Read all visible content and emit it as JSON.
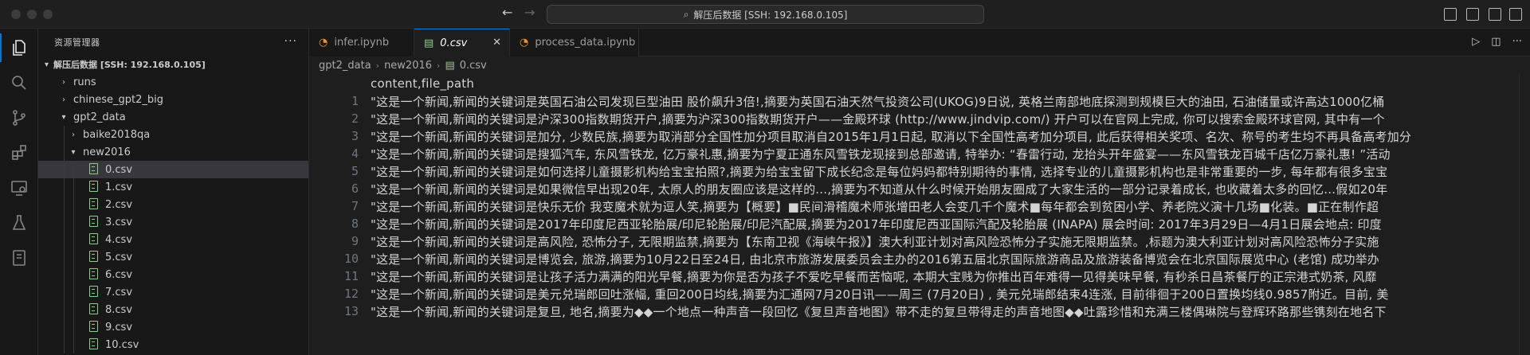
{
  "titlebar": {
    "back_icon": "arrow-left-icon",
    "forward_icon": "arrow-right-icon",
    "search_text": "解压后数据 [SSH: 192.168.0.105]"
  },
  "sidebar": {
    "title": "资源管理器",
    "more_label": "···",
    "section_label": "解压后数据 [SSH: 192.168.0.105]",
    "tree": [
      {
        "label": "runs",
        "type": "folder",
        "depth": 1,
        "expanded": false
      },
      {
        "label": "chinese_gpt2_big",
        "type": "folder",
        "depth": 1,
        "expanded": false
      },
      {
        "label": "gpt2_data",
        "type": "folder",
        "depth": 1,
        "expanded": true
      },
      {
        "label": "baike2018qa",
        "type": "folder",
        "depth": 2,
        "expanded": false
      },
      {
        "label": "new2016",
        "type": "folder",
        "depth": 2,
        "expanded": true
      },
      {
        "label": "0.csv",
        "type": "csv",
        "depth": 3,
        "selected": true
      },
      {
        "label": "1.csv",
        "type": "csv",
        "depth": 3
      },
      {
        "label": "2.csv",
        "type": "csv",
        "depth": 3
      },
      {
        "label": "3.csv",
        "type": "csv",
        "depth": 3
      },
      {
        "label": "4.csv",
        "type": "csv",
        "depth": 3
      },
      {
        "label": "5.csv",
        "type": "csv",
        "depth": 3
      },
      {
        "label": "6.csv",
        "type": "csv",
        "depth": 3
      },
      {
        "label": "7.csv",
        "type": "csv",
        "depth": 3
      },
      {
        "label": "8.csv",
        "type": "csv",
        "depth": 3
      },
      {
        "label": "9.csv",
        "type": "csv",
        "depth": 3
      },
      {
        "label": "10.csv",
        "type": "csv",
        "depth": 3
      }
    ]
  },
  "tabs": [
    {
      "label": "infer.ipynb",
      "icon": "jupyter-icon",
      "active": false
    },
    {
      "label": "0.csv",
      "icon": "csv-icon",
      "active": true,
      "italic": true
    },
    {
      "label": "process_data.ipynb",
      "icon": "jupyter-icon",
      "active": false
    }
  ],
  "breadcrumb": [
    "gpt2_data",
    "new2016",
    "0.csv"
  ],
  "editor": {
    "lines": [
      {
        "n": "",
        "text": "content,file_path"
      },
      {
        "n": "1",
        "text": "\"这是一个新闻,新闻的关键词是英国石油公司发现巨型油田 股价飙升3倍!,摘要为英国石油天然气投资公司(UKOG)9日说, 英格兰南部地底探测到规模巨大的油田, 石油储量或许高达1000亿桶"
      },
      {
        "n": "2",
        "text": "\"这是一个新闻,新闻的关键词是沪深300指数期货开户,摘要为沪深300指数期货开户——金殿环球 (http://www.jindvip.com/) 开户可以在官网上完成, 你可以搜索金殿环球官网, 其中有一个"
      },
      {
        "n": "3",
        "text": "\"这是一个新闻,新闻的关键词是加分, 少数民族,摘要为取消部分全国性加分项目取消自2015年1月1日起, 取消以下全国性高考加分项目, 此后获得相关奖项、名次、称号的考生均不再具备高考加分"
      },
      {
        "n": "4",
        "text": "\"这是一个新闻,新闻的关键词是搜狐汽车, 东风雪铁龙, 亿万豪礼惠,摘要为宁夏正通东风雪铁龙现接到总部邀请, 特举办: “春雷行动, 龙抬头开年盛宴——东风雪铁龙百城千店亿万豪礼惠! ”活动"
      },
      {
        "n": "5",
        "text": "\"这是一个新闻,新闻的关键词是如何选择儿童摄影机构给宝宝拍照?,摘要为给宝宝留下成长纪念是每位妈妈都特别期待的事情, 选择专业的儿童摄影机构也是非常重要的一步, 每年都有很多宝宝"
      },
      {
        "n": "6",
        "text": "\"这是一个新闻,新闻的关键词是如果微信早出现20年, 太原人的朋友圈应该是这样的...,摘要为不知道从什么时候开始朋友圈成了大家生活的一部分记录着成长, 也收藏着太多的回忆…假如20年"
      },
      {
        "n": "7",
        "text": "\"这是一个新闻,新闻的关键词是快乐无价      我变魔术就为逗人笑,摘要为【概要】■民间滑稽魔术师张增田老人会变几千个魔术■每年都会到贫困小学、养老院义演十几场■化装。■正在制作超"
      },
      {
        "n": "8",
        "text": "\"这是一个新闻,新闻的关键词是2017年印度尼西亚轮胎展/印尼轮胎展/印尼汽配展,摘要为2017年印度尼西亚国际汽配及轮胎展 (INAPA) 展会时间: 2017年3月29日—4月1日展会地点: 印度"
      },
      {
        "n": "9",
        "text": "\"这是一个新闻,新闻的关键词是高风险, 恐怖分子, 无限期监禁,摘要为【东南卫视《海峡午报》】澳大利亚计划对高风险恐怖分子实施无限期监禁。,标题为澳大利亚计划对高风险恐怖分子实施"
      },
      {
        "n": "10",
        "text": "\"这是一个新闻,新闻的关键词是博览会, 旅游,摘要为10月22日至24日, 由北京市旅游发展委员会主办的2016第五届北京国际旅游商品及旅游装备博览会在北京国际展览中心 (老馆) 成功举办"
      },
      {
        "n": "11",
        "text": "\"这是一个新闻,新闻的关键词是让孩子活力满满的阳光早餐,摘要为你是否为孩子不爱吃早餐而苦恼呢, 本期大宝贱为你推出百年难得一见得美味早餐, 有秒杀日昌茶餐厅的正宗港式奶茶, 风靡"
      },
      {
        "n": "12",
        "text": "\"这是一个新闻,新闻的关键词是美元兑瑞郎回吐涨幅, 重回200日均线,摘要为汇通网7月20日讯——周三 (7月20日) , 美元兑瑞郎结束4连涨, 目前徘徊于200日置换均线0.9857附近。目前, 美"
      },
      {
        "n": "13",
        "text": "\"这是一个新闻,新闻的关键词是复旦, 地名,摘要为◆◆一个地点一种声音一段回忆《复旦声音地图》带不走的复旦带得走的声音地图◆◆吐露珍惜和充满三楼偶琳院与登辉环路那些镌刻在地名下"
      }
    ]
  }
}
